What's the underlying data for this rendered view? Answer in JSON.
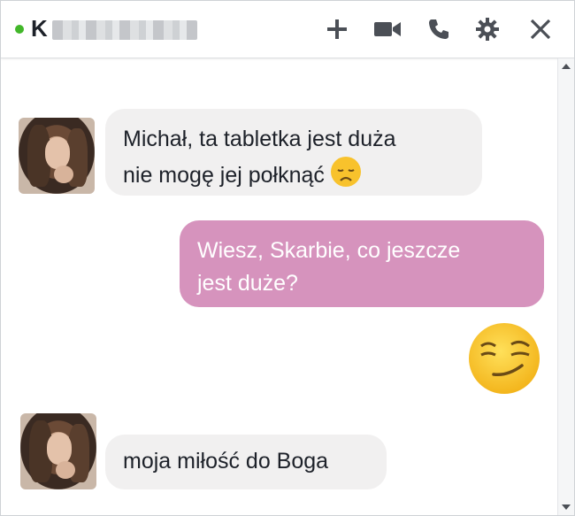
{
  "header": {
    "contact_initial": "K",
    "presence_color": "#42b72a",
    "actions": [
      {
        "icon": "plus-icon",
        "label": "Add people"
      },
      {
        "icon": "video-camera-icon",
        "label": "Video call"
      },
      {
        "icon": "phone-icon",
        "label": "Voice call"
      },
      {
        "icon": "gear-icon",
        "label": "Settings"
      },
      {
        "icon": "close-icon",
        "label": "Close"
      }
    ]
  },
  "colors": {
    "incoming_bubble": "#f1f0f0",
    "outgoing_bubble": "#d693bd",
    "text": "#1d2129"
  },
  "messages": [
    {
      "direction": "incoming",
      "text_line1": "Michał, ta tabletka jest duża",
      "text_line2": "nie mogę jej połknąć",
      "emoji": "disappointed-face-emoji"
    },
    {
      "direction": "outgoing",
      "text_line1": "Wiesz, Skarbie, co jeszcze",
      "text_line2": "jest duże?"
    },
    {
      "direction": "outgoing",
      "emoji": "smirking-face-emoji"
    },
    {
      "direction": "incoming",
      "text_line1": "moja miłość do Boga"
    }
  ]
}
